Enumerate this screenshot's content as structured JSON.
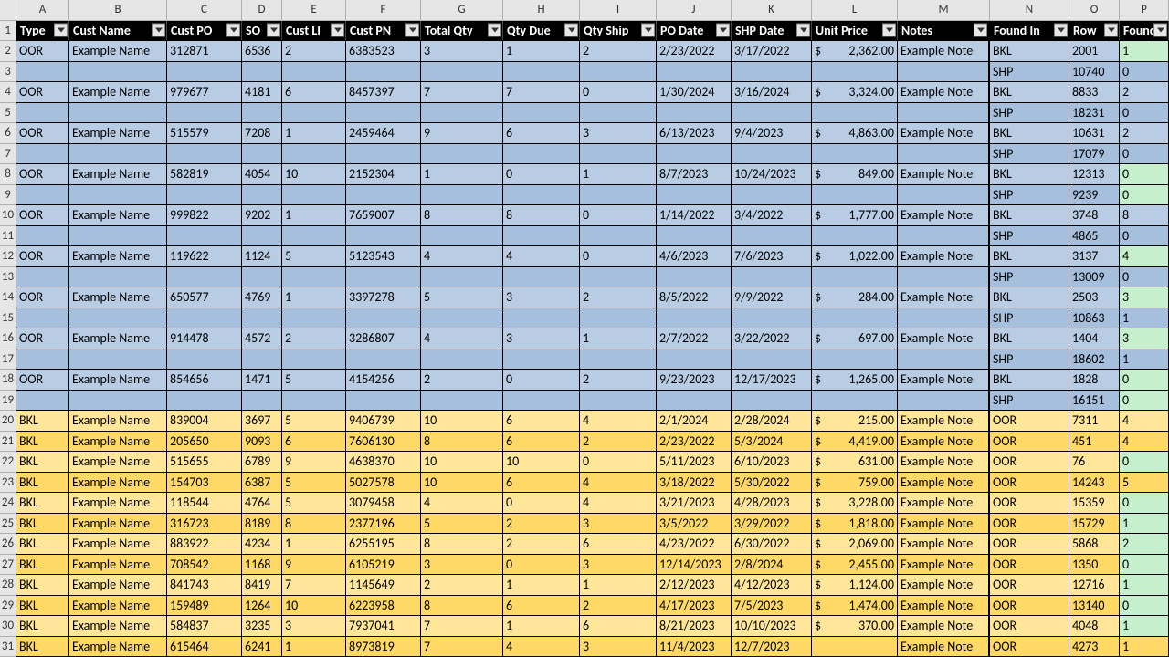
{
  "colLetters": [
    "A",
    "B",
    "C",
    "D",
    "E",
    "F",
    "G",
    "H",
    "I",
    "J",
    "K",
    "L",
    "M",
    "N",
    "O",
    "P"
  ],
  "rowNumbers": [
    "1",
    "2",
    "3",
    "4",
    "5",
    "6",
    "7",
    "8",
    "9",
    "10",
    "11",
    "12",
    "13",
    "14",
    "15",
    "16",
    "17",
    "18",
    "19",
    "20",
    "21",
    "22",
    "23",
    "24",
    "25",
    "26",
    "27",
    "28",
    "29",
    "30",
    "31"
  ],
  "headers": [
    "Type",
    "Cust Name",
    "Cust PO",
    "SO",
    "Cust LI",
    "Cust PN",
    "Total Qty",
    "Qty Due",
    "Qty Ship",
    "PO Date",
    "SHP Date",
    "Unit Price",
    "Notes",
    "Found In",
    "Row",
    "Found"
  ],
  "rows": [
    {
      "bg": "blue",
      "type": "OOR",
      "cn": "Example Name",
      "cpo": "312871",
      "so": "6536",
      "cli": "2",
      "cpn": "6383523",
      "tq": "3",
      "qd": "1",
      "qs": "2",
      "pod": "2/23/2022",
      "shd": "3/17/2022",
      "up": "2,362.00",
      "notes": "Example Note",
      "fi": "BKL",
      "row": "2001",
      "fnd": "1",
      "fbg": "green"
    },
    {
      "bg": "blue2",
      "sub": true,
      "fi": "SHP",
      "row": "10740",
      "fnd": "0",
      "fbg": "blue2"
    },
    {
      "bg": "blue",
      "type": "OOR",
      "cn": "Example Name",
      "cpo": "979677",
      "so": "4181",
      "cli": "6",
      "cpn": "8457397",
      "tq": "7",
      "qd": "7",
      "qs": "0",
      "pod": "1/30/2024",
      "shd": "3/16/2024",
      "up": "3,324.00",
      "notes": "Example Note",
      "fi": "BKL",
      "row": "8833",
      "fnd": "2",
      "fbg": "blue"
    },
    {
      "bg": "blue2",
      "sub": true,
      "fi": "SHP",
      "row": "18231",
      "fnd": "0",
      "fbg": "blue2"
    },
    {
      "bg": "blue",
      "type": "OOR",
      "cn": "Example Name",
      "cpo": "515579",
      "so": "7208",
      "cli": "1",
      "cpn": "2459464",
      "tq": "9",
      "qd": "6",
      "qs": "3",
      "pod": "6/13/2023",
      "shd": "9/4/2023",
      "up": "4,863.00",
      "notes": "Example Note",
      "fi": "BKL",
      "row": "10631",
      "fnd": "2",
      "fbg": "blue"
    },
    {
      "bg": "blue2",
      "sub": true,
      "fi": "SHP",
      "row": "17079",
      "fnd": "0",
      "fbg": "blue2"
    },
    {
      "bg": "blue",
      "type": "OOR",
      "cn": "Example Name",
      "cpo": "582819",
      "so": "4054",
      "cli": "10",
      "cpn": "2152304",
      "tq": "1",
      "qd": "0",
      "qs": "1",
      "pod": "8/7/2023",
      "shd": "10/24/2023",
      "up": "849.00",
      "notes": "Example Note",
      "fi": "BKL",
      "row": "12313",
      "fnd": "0",
      "fbg": "green"
    },
    {
      "bg": "blue2",
      "sub": true,
      "fi": "SHP",
      "row": "9239",
      "fnd": "0",
      "fbg": "green"
    },
    {
      "bg": "blue",
      "type": "OOR",
      "cn": "Example Name",
      "cpo": "999822",
      "so": "9202",
      "cli": "1",
      "cpn": "7659007",
      "tq": "8",
      "qd": "8",
      "qs": "0",
      "pod": "1/14/2022",
      "shd": "3/4/2022",
      "up": "1,777.00",
      "notes": "Example Note",
      "fi": "BKL",
      "row": "3748",
      "fnd": "8",
      "fbg": "blue"
    },
    {
      "bg": "blue2",
      "sub": true,
      "fi": "SHP",
      "row": "4865",
      "fnd": "0",
      "fbg": "blue2"
    },
    {
      "bg": "blue",
      "type": "OOR",
      "cn": "Example Name",
      "cpo": "119622",
      "so": "1124",
      "cli": "5",
      "cpn": "5123543",
      "tq": "4",
      "qd": "4",
      "qs": "0",
      "pod": "4/6/2023",
      "shd": "7/6/2023",
      "up": "1,022.00",
      "notes": "Example Note",
      "fi": "BKL",
      "row": "3137",
      "fnd": "4",
      "fbg": "green"
    },
    {
      "bg": "blue2",
      "sub": true,
      "fi": "SHP",
      "row": "13009",
      "fnd": "0",
      "fbg": "blue2"
    },
    {
      "bg": "blue",
      "type": "OOR",
      "cn": "Example Name",
      "cpo": "650577",
      "so": "4769",
      "cli": "1",
      "cpn": "3397278",
      "tq": "5",
      "qd": "3",
      "qs": "2",
      "pod": "8/5/2022",
      "shd": "9/9/2022",
      "up": "284.00",
      "notes": "Example Note",
      "fi": "BKL",
      "row": "2503",
      "fnd": "3",
      "fbg": "green"
    },
    {
      "bg": "blue2",
      "sub": true,
      "fi": "SHP",
      "row": "10863",
      "fnd": "1",
      "fbg": "blue2"
    },
    {
      "bg": "blue",
      "type": "OOR",
      "cn": "Example Name",
      "cpo": "914478",
      "so": "4572",
      "cli": "2",
      "cpn": "3286807",
      "tq": "4",
      "qd": "3",
      "qs": "1",
      "pod": "2/7/2022",
      "shd": "3/22/2022",
      "up": "697.00",
      "notes": "Example Note",
      "fi": "BKL",
      "row": "1404",
      "fnd": "3",
      "fbg": "green"
    },
    {
      "bg": "blue2",
      "sub": true,
      "fi": "SHP",
      "row": "18602",
      "fnd": "1",
      "fbg": "blue2"
    },
    {
      "bg": "blue",
      "type": "OOR",
      "cn": "Example Name",
      "cpo": "854656",
      "so": "1471",
      "cli": "5",
      "cpn": "4154256",
      "tq": "2",
      "qd": "0",
      "qs": "2",
      "pod": "9/23/2023",
      "shd": "12/17/2023",
      "up": "1,265.00",
      "notes": "Example Note",
      "fi": "BKL",
      "row": "1828",
      "fnd": "0",
      "fbg": "green"
    },
    {
      "bg": "blue2",
      "sub": true,
      "fi": "SHP",
      "row": "16151",
      "fnd": "0",
      "fbg": "green"
    },
    {
      "bg": "yellow",
      "type": "BKL",
      "cn": "Example Name",
      "cpo": "839004",
      "so": "3697",
      "cli": "5",
      "cpn": "9406739",
      "tq": "10",
      "qd": "6",
      "qs": "4",
      "pod": "2/1/2024",
      "shd": "2/28/2024",
      "up": "215.00",
      "notes": "Example Note",
      "fi": "OOR",
      "row": "7311",
      "fnd": "4",
      "fbg": "yellow"
    },
    {
      "bg": "yellow2",
      "type": "BKL",
      "cn": "Example Name",
      "cpo": "205650",
      "so": "9093",
      "cli": "6",
      "cpn": "7606130",
      "tq": "8",
      "qd": "6",
      "qs": "2",
      "pod": "2/23/2022",
      "shd": "5/3/2024",
      "up": "4,419.00",
      "notes": "Example Note",
      "fi": "OOR",
      "row": "451",
      "fnd": "4",
      "fbg": "yellow2"
    },
    {
      "bg": "yellow",
      "type": "BKL",
      "cn": "Example Name",
      "cpo": "515655",
      "so": "6789",
      "cli": "9",
      "cpn": "4638370",
      "tq": "10",
      "qd": "10",
      "qs": "0",
      "pod": "5/11/2023",
      "shd": "6/10/2023",
      "up": "631.00",
      "notes": "Example Note",
      "fi": "OOR",
      "row": "76",
      "fnd": "0",
      "fbg": "green"
    },
    {
      "bg": "yellow2",
      "type": "BKL",
      "cn": "Example Name",
      "cpo": "154703",
      "so": "6387",
      "cli": "5",
      "cpn": "5027578",
      "tq": "10",
      "qd": "6",
      "qs": "4",
      "pod": "3/18/2022",
      "shd": "5/30/2022",
      "up": "759.00",
      "notes": "Example Note",
      "fi": "OOR",
      "row": "14243",
      "fnd": "5",
      "fbg": "yellow2"
    },
    {
      "bg": "yellow",
      "type": "BKL",
      "cn": "Example Name",
      "cpo": "118544",
      "so": "4764",
      "cli": "5",
      "cpn": "3079458",
      "tq": "4",
      "qd": "0",
      "qs": "4",
      "pod": "3/21/2023",
      "shd": "4/28/2023",
      "up": "3,228.00",
      "notes": "Example Note",
      "fi": "OOR",
      "row": "15359",
      "fnd": "0",
      "fbg": "green"
    },
    {
      "bg": "yellow2",
      "type": "BKL",
      "cn": "Example Name",
      "cpo": "316723",
      "so": "8189",
      "cli": "8",
      "cpn": "2377196",
      "tq": "5",
      "qd": "2",
      "qs": "3",
      "pod": "3/5/2022",
      "shd": "3/29/2022",
      "up": "1,818.00",
      "notes": "Example Note",
      "fi": "OOR",
      "row": "15729",
      "fnd": "1",
      "fbg": "green"
    },
    {
      "bg": "yellow",
      "type": "BKL",
      "cn": "Example Name",
      "cpo": "883922",
      "so": "4234",
      "cli": "1",
      "cpn": "6255195",
      "tq": "8",
      "qd": "2",
      "qs": "6",
      "pod": "4/23/2022",
      "shd": "6/30/2022",
      "up": "2,069.00",
      "notes": "Example Note",
      "fi": "OOR",
      "row": "5868",
      "fnd": "2",
      "fbg": "green"
    },
    {
      "bg": "yellow2",
      "type": "BKL",
      "cn": "Example Name",
      "cpo": "708542",
      "so": "1168",
      "cli": "9",
      "cpn": "6105219",
      "tq": "3",
      "qd": "0",
      "qs": "3",
      "pod": "12/14/2023",
      "shd": "2/8/2024",
      "up": "2,455.00",
      "notes": "Example Note",
      "fi": "OOR",
      "row": "1350",
      "fnd": "0",
      "fbg": "green"
    },
    {
      "bg": "yellow",
      "type": "BKL",
      "cn": "Example Name",
      "cpo": "841743",
      "so": "8419",
      "cli": "7",
      "cpn": "1145649",
      "tq": "2",
      "qd": "1",
      "qs": "1",
      "pod": "2/12/2023",
      "shd": "4/12/2023",
      "up": "1,124.00",
      "notes": "Example Note",
      "fi": "OOR",
      "row": "12716",
      "fnd": "1",
      "fbg": "green"
    },
    {
      "bg": "yellow2",
      "type": "BKL",
      "cn": "Example Name",
      "cpo": "159489",
      "so": "1264",
      "cli": "10",
      "cpn": "6223958",
      "tq": "8",
      "qd": "6",
      "qs": "2",
      "pod": "4/17/2023",
      "shd": "7/5/2023",
      "up": "1,474.00",
      "notes": "Example Note",
      "fi": "OOR",
      "row": "13140",
      "fnd": "0",
      "fbg": "green"
    },
    {
      "bg": "yellow",
      "type": "BKL",
      "cn": "Example Name",
      "cpo": "584837",
      "so": "3235",
      "cli": "3",
      "cpn": "7937041",
      "tq": "7",
      "qd": "1",
      "qs": "6",
      "pod": "8/21/2023",
      "shd": "10/10/2023",
      "up": "370.00",
      "notes": "Example Note",
      "fi": "OOR",
      "row": "4048",
      "fnd": "1",
      "fbg": "green"
    },
    {
      "bg": "yellow2",
      "type": "BKL",
      "cn": "Example Name",
      "cpo": "615464",
      "so": "6241",
      "cli": "1",
      "cpn": "8973819",
      "tq": "7",
      "qd": "4",
      "qs": "3",
      "pod": "11/4/2023",
      "shd": "12/7/2023",
      "up": "",
      "notes": "Example Note",
      "fi": "OOR",
      "row": "4273",
      "fnd": "1",
      "fbg": "yellow2"
    }
  ]
}
